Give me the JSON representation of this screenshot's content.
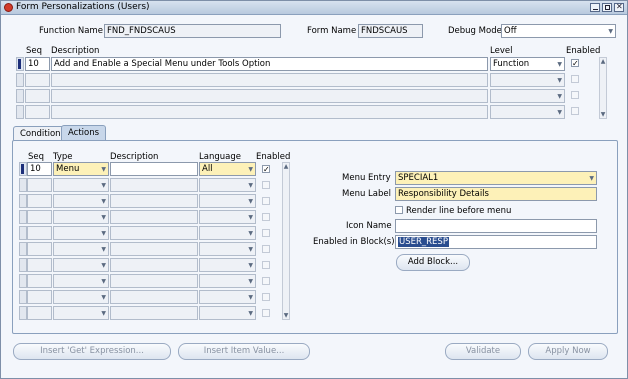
{
  "window": {
    "title": "Form Personalizations (Users)"
  },
  "header": {
    "function_name_label": "Function Name",
    "function_name_value": "FND_FNDSCAUS",
    "form_name_label": "Form Name",
    "form_name_value": "FNDSCAUS",
    "debug_mode_label": "Debug Mode",
    "debug_mode_value": "Off"
  },
  "rules": {
    "headers": {
      "seq": "Seq",
      "description": "Description",
      "level": "Level",
      "enabled": "Enabled"
    },
    "rows": [
      {
        "seq": "10",
        "description": "Add and Enable a Special Menu under Tools Option",
        "level": "Function",
        "enabled": true
      },
      {
        "seq": "",
        "description": "",
        "level": "",
        "enabled": false
      },
      {
        "seq": "",
        "description": "",
        "level": "",
        "enabled": false
      },
      {
        "seq": "",
        "description": "",
        "level": "",
        "enabled": false
      }
    ]
  },
  "tabs": [
    {
      "label": "Condition",
      "active": false
    },
    {
      "label": "Actions",
      "active": true
    }
  ],
  "actions": {
    "headers": {
      "seq": "Seq",
      "type": "Type",
      "description": "Description",
      "language": "Language",
      "enabled": "Enabled"
    },
    "rows": [
      {
        "seq": "10",
        "type": "Menu",
        "description": "",
        "language": "All",
        "enabled": true
      },
      {
        "seq": "",
        "type": "",
        "description": "",
        "language": "",
        "enabled": false
      },
      {
        "seq": "",
        "type": "",
        "description": "",
        "language": "",
        "enabled": false
      },
      {
        "seq": "",
        "type": "",
        "description": "",
        "language": "",
        "enabled": false
      },
      {
        "seq": "",
        "type": "",
        "description": "",
        "language": "",
        "enabled": false
      },
      {
        "seq": "",
        "type": "",
        "description": "",
        "language": "",
        "enabled": false
      },
      {
        "seq": "",
        "type": "",
        "description": "",
        "language": "",
        "enabled": false
      },
      {
        "seq": "",
        "type": "",
        "description": "",
        "language": "",
        "enabled": false
      },
      {
        "seq": "",
        "type": "",
        "description": "",
        "language": "",
        "enabled": false
      },
      {
        "seq": "",
        "type": "",
        "description": "",
        "language": "",
        "enabled": false
      }
    ]
  },
  "menu_props": {
    "menu_entry_label": "Menu Entry",
    "menu_entry_value": "SPECIAL1",
    "menu_label_label": "Menu Label",
    "menu_label_value": "Responsibility Details",
    "render_line_label": "Render line before menu",
    "icon_name_label": "Icon Name",
    "icon_name_value": "",
    "enabled_blocks_label": "Enabled in Block(s)",
    "enabled_blocks_value": "USER_RESP",
    "add_block_label": "Add Block..."
  },
  "footer": {
    "insert_get_label": "Insert 'Get' Expression...",
    "insert_item_label": "Insert Item Value...",
    "validate_label": "Validate",
    "apply_now_label": "Apply Now"
  },
  "colors": {
    "title_bar": "#c8d7ea",
    "highlight_yellow": "#fdf1b8",
    "selection_blue": "#2a4d8f"
  }
}
